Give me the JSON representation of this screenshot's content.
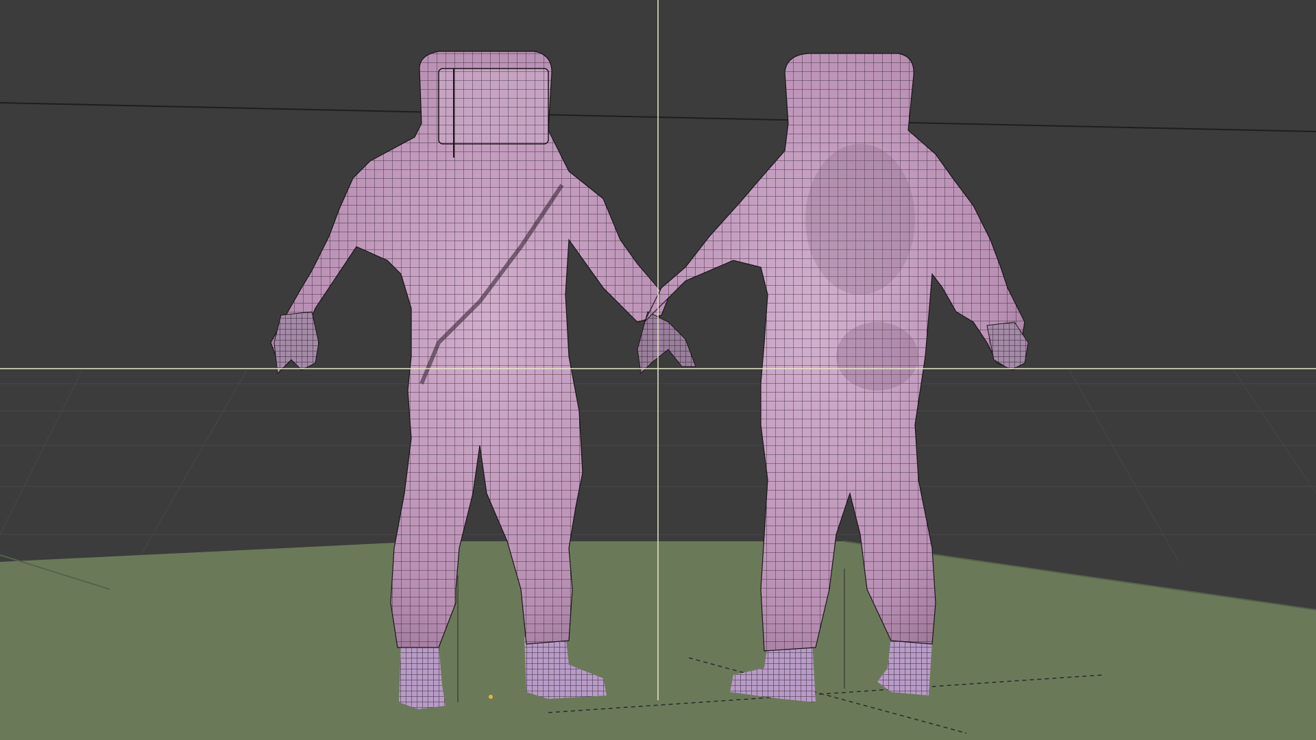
{
  "viewport": {
    "mode": "3d-viewport",
    "shading": "solid-wireframe-overlay",
    "background_color": "#3c3c3c",
    "floor_color": "#6a7a58",
    "mesh_color": "#c7a2c2",
    "mesh_shadow_color": "#8e6a8a",
    "wire_color": "#1b141b",
    "crosshair_color": "#e8e8c8",
    "grid_color": "#474747"
  },
  "scene": {
    "objects": [
      {
        "name": "hazmat-suit-front",
        "view": "front",
        "selected": false
      },
      {
        "name": "hazmat-suit-back",
        "view": "back",
        "selected": false
      }
    ],
    "icons": [
      "3d-cursor-icon",
      "object-origin-icon"
    ]
  }
}
